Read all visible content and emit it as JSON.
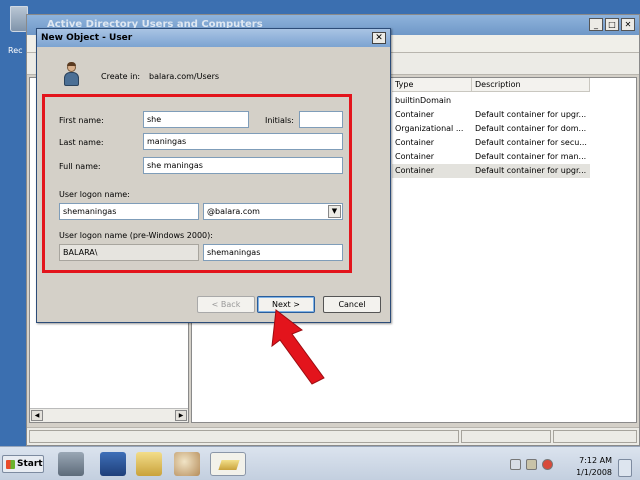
{
  "desktop": {
    "recycle_label": "Rec"
  },
  "aduc": {
    "title": "Active Directory Users and Computers",
    "list": {
      "columns": [
        "Type",
        "Description"
      ],
      "rows": [
        {
          "type": "builtinDomain",
          "description": ""
        },
        {
          "type": "Container",
          "description": "Default container for upgr..."
        },
        {
          "type": "Organizational ...",
          "description": "Default container for dom..."
        },
        {
          "type": "Container",
          "description": "Default container for secu..."
        },
        {
          "type": "Container",
          "description": "Default container for man..."
        },
        {
          "type": "Container",
          "description": "Default container for upgr..."
        }
      ]
    }
  },
  "dialog": {
    "title": "New Object - User",
    "close": "✕",
    "create_in_label": "Create in:",
    "create_in_value": "balara.com/Users",
    "first_name_label": "First name:",
    "first_name_value": "she",
    "initials_label": "Initials:",
    "initials_value": "",
    "last_name_label": "Last name:",
    "last_name_value": "maningas",
    "full_name_label": "Full name:",
    "full_name_value": "she maningas",
    "logon_name_label": "User logon name:",
    "logon_name_value": "shemaningas",
    "domain_value": "@balara.com",
    "pre2000_label": "User logon name (pre-Windows 2000):",
    "pre2000_domain": "BALARA\\",
    "pre2000_value": "shemaningas",
    "back_label": "< Back",
    "next_label": "Next >",
    "cancel_label": "Cancel"
  },
  "annotation_color": "#e3141c",
  "taskbar": {
    "start_label": "Start",
    "time": "7:12 AM",
    "date": "1/1/2008",
    "icons": [
      "server-manager-icon",
      "powershell-icon",
      "explorer-icon",
      "paint-icon",
      "aduc-icon"
    ]
  }
}
